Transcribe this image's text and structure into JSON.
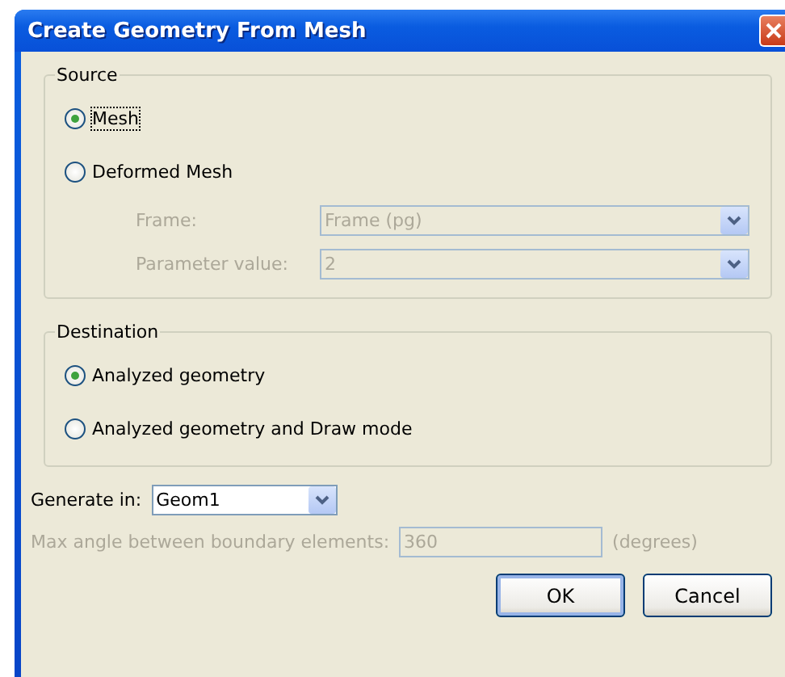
{
  "window": {
    "title": "Create Geometry From Mesh"
  },
  "source": {
    "label": "Source",
    "options": [
      {
        "label": "Mesh",
        "selected": true,
        "focused": true
      },
      {
        "label": "Deformed Mesh",
        "selected": false,
        "focused": false
      }
    ],
    "fields": [
      {
        "label": "Frame:",
        "value": "Frame (pg)",
        "disabled": true
      },
      {
        "label": "Parameter value:",
        "value": "2",
        "disabled": true
      }
    ]
  },
  "destination": {
    "label": "Destination",
    "options": [
      {
        "label": "Analyzed geometry",
        "selected": true,
        "focused": false
      },
      {
        "label": "Analyzed geometry and Draw mode",
        "selected": false,
        "focused": false
      }
    ]
  },
  "generate_in": {
    "label": "Generate in:",
    "value": "Geom1",
    "disabled": false
  },
  "max_angle": {
    "label": "Max angle between boundary elements:",
    "value": "360",
    "unit": "(degrees)",
    "disabled": true
  },
  "buttons": [
    {
      "label": "OK",
      "default": true
    },
    {
      "label": "Cancel",
      "default": false
    }
  ]
}
